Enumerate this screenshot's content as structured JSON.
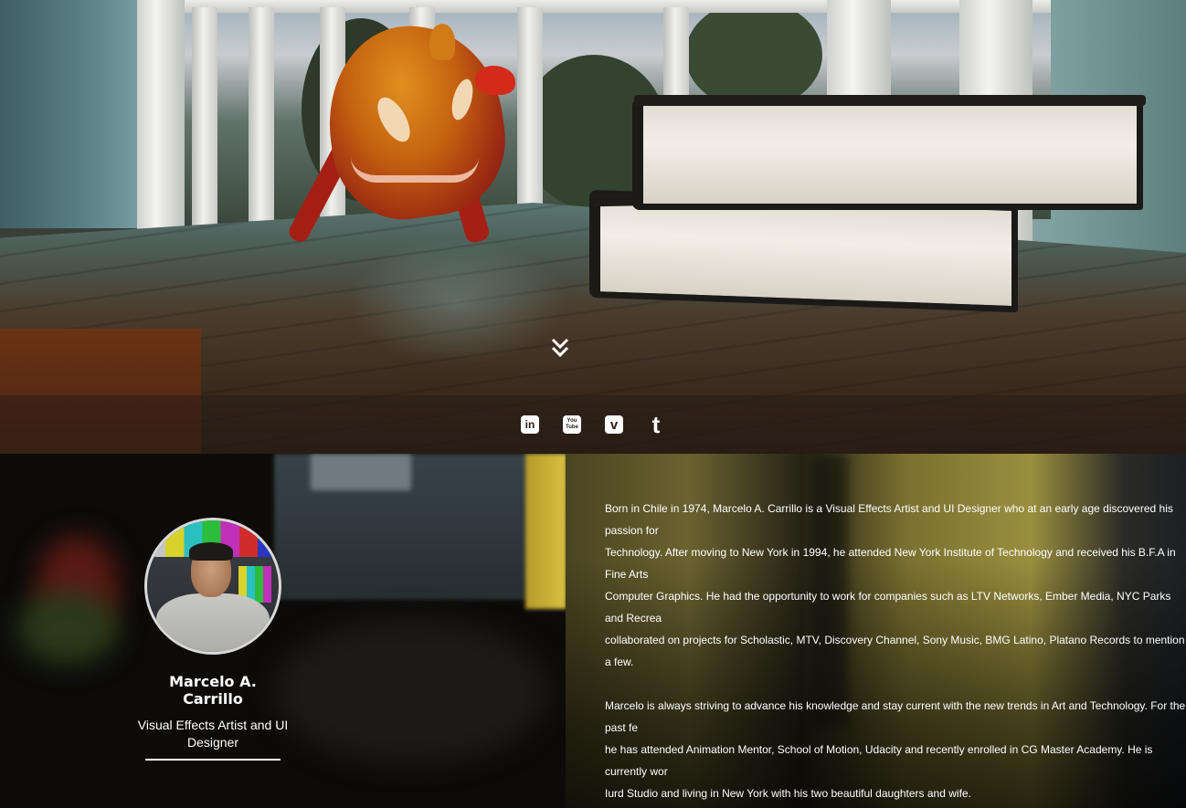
{
  "hero": {
    "scroll_icon": "double-chevron-down-icon",
    "social_links": [
      {
        "name": "linkedin",
        "glyph": "in",
        "icon": "linkedin-icon"
      },
      {
        "name": "youtube",
        "glyph": "You Tube",
        "icon": "youtube-icon"
      },
      {
        "name": "vimeo",
        "glyph": "v",
        "icon": "vimeo-icon"
      },
      {
        "name": "tumblr",
        "glyph": "t",
        "icon": "tumblr-icon"
      }
    ]
  },
  "about": {
    "name": "Marcelo A. Carrillo",
    "role": "Visual Effects Artist and UI Designer",
    "bio_paragraphs": [
      "Born in Chile in 1974, Marcelo A. Carrillo is a Visual Effects Artist and UI Designer who at an early age discovered his passion for\nTechnology. After moving to New York in 1994, he attended New York Institute of Technology and received his B.F.A in Fine Arts\nComputer Graphics. He had the opportunity to work for companies such as LTV Networks, Ember Media, NYC Parks and Recrea\ncollaborated on projects for Scholastic, MTV, Discovery Channel, Sony Music, BMG Latino, Platano Records to mention a few.",
      "Marcelo is always striving to advance his knowledge and stay current with the new trends in Art and Technology. For the past fe\nhe has attended Animation Mentor, School of Motion, Udacity and recently enrolled in CG Master Academy. He is currently wor\nIurd Studio and living in New York with his two beautiful daughters and wife."
    ]
  },
  "colors": {
    "text": "#ffffff",
    "social_bar": "#2a2018",
    "avatar_border": "#d9d9d9"
  }
}
